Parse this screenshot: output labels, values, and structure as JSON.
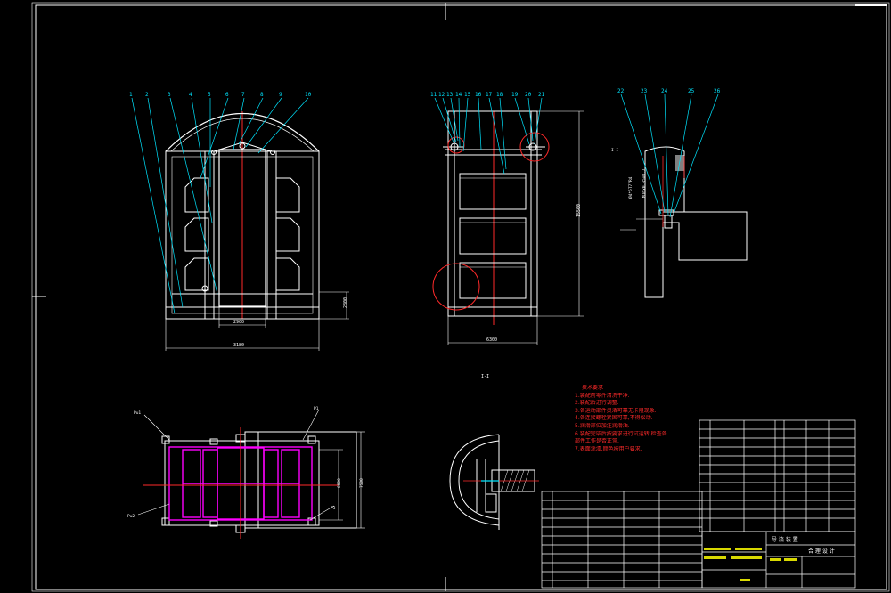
{
  "colors": {
    "background": "#000000",
    "frame": "#ffffff",
    "leader": "#00e5ff",
    "centerline": "#ff2a2a",
    "fixture": "#ff00ff",
    "notes": "#ff2a2a",
    "title_block": "#ffffff",
    "highlight": "#ffff00"
  },
  "views": {
    "front": {
      "labels": [
        "1",
        "2",
        "3",
        "4",
        "5",
        "6",
        "7",
        "8",
        "9",
        "10"
      ],
      "dims": {
        "overall_width": "3180",
        "inner_width": "2900",
        "right_height": "2800"
      }
    },
    "side": {
      "labels": [
        "11",
        "12",
        "13",
        "14",
        "15",
        "16",
        "17",
        "18",
        "19",
        "20",
        "21"
      ],
      "dims": {
        "width": "6300",
        "height": "15500"
      }
    },
    "detail_top": {
      "labels": [
        "22",
        "23",
        "24",
        "25",
        "26"
      ],
      "dims": [
        "I-I",
        "M16x0.35x0.7",
        "Ø4*5T77R4"
      ]
    },
    "plan": {
      "title": "I-I",
      "dims": {
        "inner": "6800",
        "outer": "7500"
      },
      "tags": [
        "Pu1",
        "P1",
        "Pu2",
        "P3"
      ]
    }
  },
  "technical_notes": {
    "title": "技术要求",
    "lines": [
      "1.装配前零件清洗干净.",
      "2.装配后进行调整.",
      "3.各运动部件灵活可靠无卡阻现象.",
      "4.各连接螺栓紧固可靠,不得松动.",
      "5.润滑部位加注润滑油.",
      "6.装配完毕后按要求进行试运转,检查各",
      "  部件工作是否正常.",
      "7.表面涂漆,颜色按用户要求."
    ]
  },
  "title_block": {
    "main_title": "导 流 装 置",
    "sub_title": "合 理 设 计"
  }
}
